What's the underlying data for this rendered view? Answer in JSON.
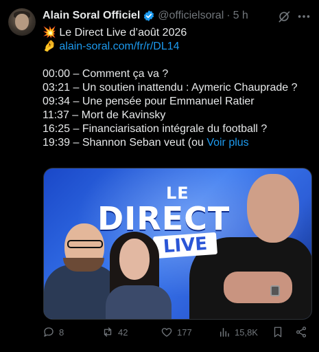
{
  "tweet": {
    "author_name": "Alain Soral Officiel",
    "handle": "@officielsoral",
    "separator": "·",
    "time": "5 h",
    "lines": [
      "💥 Le Direct Live d’août 2026",
      "🤌"
    ],
    "link": "alain-soral.com/fr/r/DL14",
    "timestamps": [
      "00:00 – Comment ça va ?",
      "03:21 – Un soutien inattendu : Aymeric Chauprade ?",
      "09:34 – Une pensée pour Emmanuel Ratier",
      "11:37 – Mort de Kavinsky",
      "16:25 – Financiarisation intégrale du football ?",
      "19:39 – Shannon Seban veut (ou"
    ],
    "more_label": "Voir plus",
    "media": {
      "title_small": "LE",
      "title_big": "DIRECT",
      "title_badge": "LIVE"
    },
    "actions": {
      "replies": "8",
      "reposts": "42",
      "likes": "177",
      "views": "15,8K"
    }
  },
  "colors": {
    "background": "#000000",
    "text": "#e7e9ea",
    "muted": "#71767b",
    "link": "#1d9bf0",
    "verified": "#1d9bf0"
  },
  "icons": {
    "verified": "verified-badge-icon",
    "grok": "grok-icon",
    "more": "more-icon",
    "reply": "reply-icon",
    "repost": "repost-icon",
    "like": "heart-icon",
    "views": "views-icon",
    "bookmark": "bookmark-icon",
    "share": "share-icon"
  }
}
